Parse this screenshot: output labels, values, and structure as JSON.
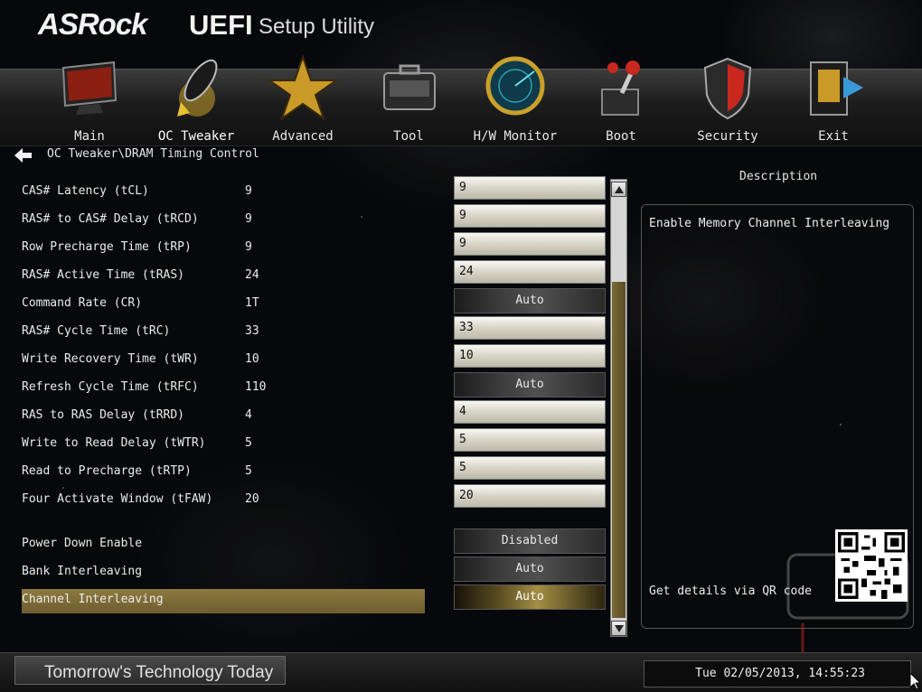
{
  "brand": {
    "asrock": "ASRock",
    "uefi": "UEFI",
    "subtitle": "Setup Utility"
  },
  "nav": {
    "active": "oc-tweaker",
    "items": [
      {
        "label": "Main",
        "icon": "monitor-icon"
      },
      {
        "label": "OC Tweaker",
        "icon": "rocket-icon"
      },
      {
        "label": "Advanced",
        "icon": "star-icon"
      },
      {
        "label": "Tool",
        "icon": "toolbox-icon"
      },
      {
        "label": "H/W Monitor",
        "icon": "radar-icon"
      },
      {
        "label": "Boot",
        "icon": "joystick-icon"
      },
      {
        "label": "Security",
        "icon": "shield-icon"
      },
      {
        "label": "Exit",
        "icon": "exit-door-icon"
      }
    ]
  },
  "breadcrumb": "OC Tweaker\\DRAM Timing Control",
  "settings": [
    {
      "label": "CAS# Latency (tCL)",
      "current": "9",
      "value": "9",
      "control": "field"
    },
    {
      "label": "RAS# to CAS# Delay (tRCD)",
      "current": "9",
      "value": "9",
      "control": "field"
    },
    {
      "label": "Row Precharge Time (tRP)",
      "current": "9",
      "value": "9",
      "control": "field"
    },
    {
      "label": "RAS# Active Time (tRAS)",
      "current": "24",
      "value": "24",
      "control": "field"
    },
    {
      "label": "Command Rate (CR)",
      "current": "1T",
      "value": "Auto",
      "control": "button"
    },
    {
      "label": "RAS# Cycle Time (tRC)",
      "current": "33",
      "value": "33",
      "control": "field"
    },
    {
      "label": "Write Recovery Time (tWR)",
      "current": "10",
      "value": "10",
      "control": "field"
    },
    {
      "label": "Refresh Cycle Time (tRFC)",
      "current": "110",
      "value": "Auto",
      "control": "button"
    },
    {
      "label": "RAS to RAS Delay (tRRD)",
      "current": "4",
      "value": "4",
      "control": "field"
    },
    {
      "label": "Write to Read Delay (tWTR)",
      "current": "5",
      "value": "5",
      "control": "field"
    },
    {
      "label": "Read to Precharge (tRTP)",
      "current": "5",
      "value": "5",
      "control": "field"
    },
    {
      "label": "Four Activate Window (tFAW)",
      "current": "20",
      "value": "20",
      "control": "field"
    },
    {
      "label": "Power Down Enable",
      "current": "",
      "value": "Disabled",
      "control": "button"
    },
    {
      "label": "Bank Interleaving",
      "current": "",
      "value": "Auto",
      "control": "button"
    },
    {
      "label": "Channel Interleaving",
      "current": "",
      "value": "Auto",
      "control": "button",
      "selected": true
    }
  ],
  "description": {
    "title": "Description",
    "text": "Enable Memory Channel Interleaving",
    "qr_text": "Get details via QR code"
  },
  "footer": {
    "tagline": "Tomorrow's Technology Today",
    "datetime": "Tue 02/05/2013, 14:55:23"
  },
  "colors": {
    "accent_gold": "#8d7a40",
    "field_light": "#dad7ca"
  }
}
